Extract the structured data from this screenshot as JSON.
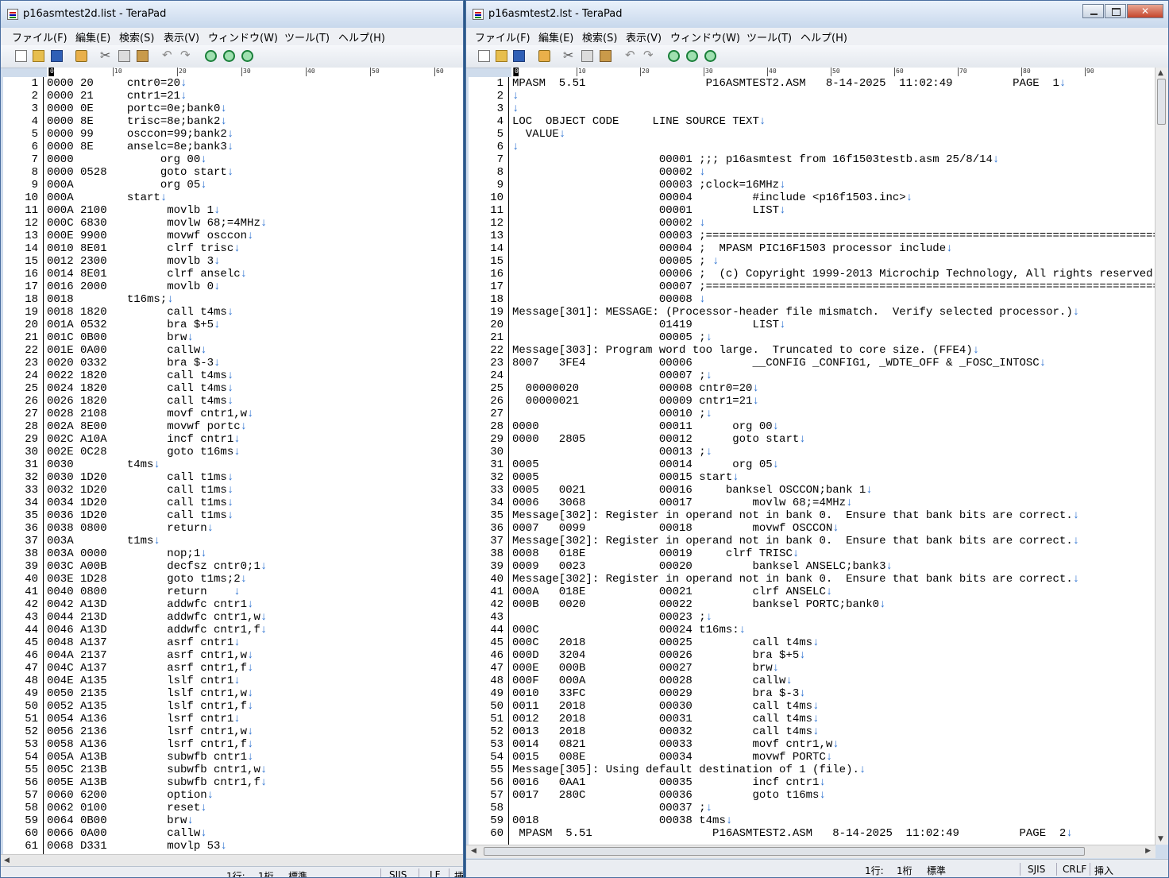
{
  "left_window": {
    "title": "p16asmtest2d.list - TeraPad",
    "menu": [
      "ファイル(F)",
      "編集(E)",
      "検索(S)",
      "表示(V)",
      "ウィンドウ(W)",
      "ツール(T)",
      "ヘルプ(H)"
    ],
    "toolbar_icons": [
      "new-file-icon",
      "open-folder-icon",
      "save-icon",
      "print-icon",
      "cut-icon",
      "copy-icon",
      "paste-icon",
      "undo-icon",
      "redo-icon",
      "find-icon",
      "find-next-icon",
      "find-prev-icon"
    ],
    "ruler_marks": [
      "0",
      "10",
      "20",
      "30",
      "40",
      "50",
      "60"
    ],
    "lines": [
      "0000 20     cntr0=20↓",
      "0000 21     cntr1=21↓",
      "0000 0E     portc=0e;bank0↓",
      "0000 8E     trisc=8e;bank2↓",
      "0000 99     osccon=99;bank2↓",
      "0000 8E     anselc=8e;bank3↓",
      "0000             org 00↓",
      "0000 0528        goto start↓",
      "000A             org 05↓",
      "000A        start↓",
      "000A 2100         movlb 1↓",
      "000C 6830         movlw 68;=4MHz↓",
      "000E 9900         movwf osccon↓",
      "0010 8E01         clrf trisc↓",
      "0012 2300         movlb 3↓",
      "0014 8E01         clrf anselc↓",
      "0016 2000         movlb 0↓",
      "0018        t16ms;↓",
      "0018 1820         call t4ms↓",
      "001A 0532         bra $+5↓",
      "001C 0B00         brw↓",
      "001E 0A00         callw↓",
      "0020 0332         bra $-3↓",
      "0022 1820         call t4ms↓",
      "0024 1820         call t4ms↓",
      "0026 1820         call t4ms↓",
      "0028 2108         movf cntr1,w↓",
      "002A 8E00         movwf portc↓",
      "002C A10A         incf cntr1↓",
      "002E 0C28         goto t16ms↓",
      "0030        t4ms↓",
      "0030 1D20         call t1ms↓",
      "0032 1D20         call t1ms↓",
      "0034 1D20         call t1ms↓",
      "0036 1D20         call t1ms↓",
      "0038 0800         return↓",
      "003A        t1ms↓",
      "003A 0000         nop;1↓",
      "003C A00B         decfsz cntr0;1↓",
      "003E 1D28         goto t1ms;2↓",
      "0040 0800         return    ↓",
      "0042 A13D         addwfc cntr1↓",
      "0044 213D         addwfc cntr1,w↓",
      "0046 A13D         addwfc cntr1,f↓",
      "0048 A137         asrf cntr1↓",
      "004A 2137         asrf cntr1,w↓",
      "004C A137         asrf cntr1,f↓",
      "004E A135         lslf cntr1↓",
      "0050 2135         lslf cntr1,w↓",
      "0052 A135         lslf cntr1,f↓",
      "0054 A136         lsrf cntr1↓",
      "0056 2136         lsrf cntr1,w↓",
      "0058 A136         lsrf cntr1,f↓",
      "005A A13B         subwfb cntr1↓",
      "005C 213B         subwfb cntr1,w↓",
      "005E A13B         subwfb cntr1,f↓",
      "0060 6200         option↓",
      "0062 0100         reset↓",
      "0064 0B00         brw↓",
      "0066 0A00         callw↓",
      "0068 D331         movlp 53↓"
    ],
    "status": {
      "pos_line": "1行:",
      "pos_col": "1桁",
      "mode": "標準",
      "encoding": "SJIS",
      "newline": "LF",
      "insert": "挿"
    }
  },
  "right_window": {
    "title": "p16asmtest2.lst - TeraPad",
    "menu": [
      "ファイル(F)",
      "編集(E)",
      "検索(S)",
      "表示(V)",
      "ウィンドウ(W)",
      "ツール(T)",
      "ヘルプ(H)"
    ],
    "toolbar_icons": [
      "new-file-icon",
      "open-folder-icon",
      "save-icon",
      "print-icon",
      "cut-icon",
      "copy-icon",
      "paste-icon",
      "undo-icon",
      "redo-icon",
      "find-icon",
      "find-next-icon",
      "find-prev-icon"
    ],
    "ruler_marks": [
      "0",
      "10",
      "20",
      "30",
      "40",
      "50",
      "60",
      "70",
      "80",
      "90"
    ],
    "lines": [
      "MPASM  5.51                  P16ASMTEST2.ASM   8-14-2025  11:02:49         PAGE  1↓",
      "↓",
      "↓",
      "LOC  OBJECT CODE     LINE SOURCE TEXT↓",
      "  VALUE↓",
      "↓",
      "                      00001 ;;; p16asmtest from 16f1503testb.asm 25/8/14↓",
      "                      00002 ↓",
      "                      00003 ;clock=16MHz↓",
      "                      00004         #include <p16f1503.inc>↓",
      "                      00001         LIST↓",
      "                      00002 ↓",
      "                      00003 ;==========================================================================",
      "                      00004 ;  MPASM PIC16F1503 processor include↓",
      "                      00005 ; ↓",
      "                      00006 ;  (c) Copyright 1999-2013 Microchip Technology, All rights reserved↓",
      "                      00007 ;==========================================================================",
      "                      00008 ↓",
      "Message[301]: MESSAGE: (Processor-header file mismatch.  Verify selected processor.)↓",
      "                      01419         LIST↓",
      "                      00005 ;↓",
      "Message[303]: Program word too large.  Truncated to core size. (FFE4)↓",
      "8007   3FE4           00006         __CONFIG _CONFIG1, _WDTE_OFF & _FOSC_INTOSC↓",
      "                      00007 ;↓",
      "  00000020            00008 cntr0=20↓",
      "  00000021            00009 cntr1=21↓",
      "                      00010 ;↓",
      "0000                  00011      org 00↓",
      "0000   2805           00012      goto start↓",
      "                      00013 ;↓",
      "0005                  00014      org 05↓",
      "0005                  00015 start↓",
      "0005   0021           00016     banksel OSCCON;bank 1↓",
      "0006   3068           00017         movlw 68;=4MHz↓",
      "Message[302]: Register in operand not in bank 0.  Ensure that bank bits are correct.↓",
      "0007   0099           00018         movwf OSCCON↓",
      "Message[302]: Register in operand not in bank 0.  Ensure that bank bits are correct.↓",
      "0008   018E           00019     clrf TRISC↓",
      "0009   0023           00020         banksel ANSELC;bank3↓",
      "Message[302]: Register in operand not in bank 0.  Ensure that bank bits are correct.↓",
      "000A   018E           00021         clrf ANSELC↓",
      "000B   0020           00022         banksel PORTC;bank0↓",
      "                      00023 ;↓",
      "000C                  00024 t16ms:↓",
      "000C   2018           00025         call t4ms↓",
      "000D   3204           00026         bra $+5↓",
      "000E   000B           00027         brw↓",
      "000F   000A           00028         callw↓",
      "0010   33FC           00029         bra $-3↓",
      "0011   2018           00030         call t4ms↓",
      "0012   2018           00031         call t4ms↓",
      "0013   2018           00032         call t4ms↓",
      "0014   0821           00033         movf cntr1,w↓",
      "0015   008E           00034         movwf PORTC↓",
      "Message[305]: Using default destination of 1 (file).↓",
      "0016   0AA1           00035         incf cntr1↓",
      "0017   280C           00036         goto t16ms↓",
      "                      00037 ;↓",
      "0018                  00038 t4ms↓",
      " MPASM  5.51                  P16ASMTEST2.ASM   8-14-2025  11:02:49         PAGE  2↓"
    ],
    "status": {
      "pos_line": "1行:",
      "pos_col": "1桁",
      "mode": "標準",
      "encoding": "SJIS",
      "newline": "CRLF",
      "insert": "挿入"
    }
  }
}
